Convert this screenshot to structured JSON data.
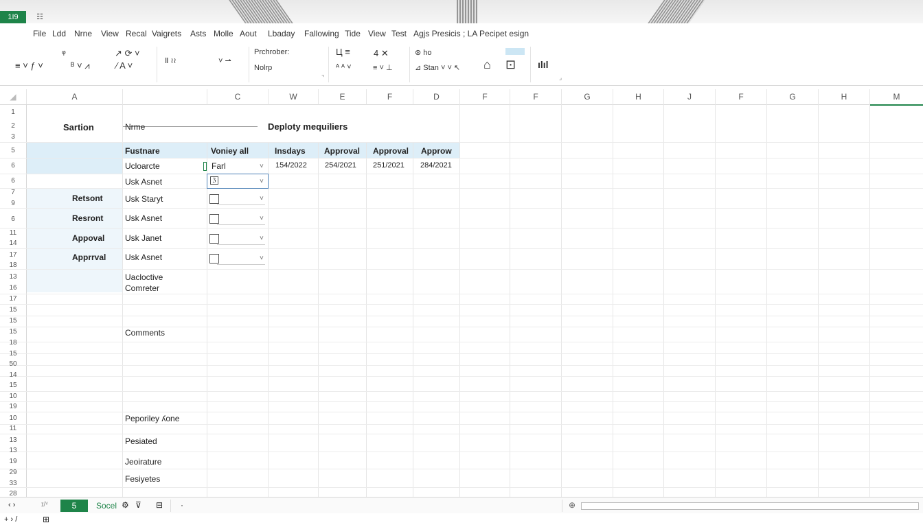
{
  "app": {
    "badge": "1I9",
    "grid_icon": "☷"
  },
  "menu": [
    "File",
    "Ldd",
    "Nrne",
    "View",
    "Recal",
    "Vaigrets",
    "Asts",
    "Molle",
    "Aout",
    "Lbaday",
    "Fallowing",
    "Tide",
    "View",
    "Test",
    "Agjs Presicis ; LA Pecipet esign"
  ],
  "ribbon": {
    "t1": "≡ ˅  ƒ  ˅",
    "t2": "ᵠ",
    "t3": "↗  ⟳  ˅",
    "t4": "ᴮ ˅  ⩘",
    "t5": "⁄  A  ˅",
    "t6": "Ⅱ ≀≀",
    "t7": "˅  ⇀",
    "t8": "Prchrober:",
    "t9": "Nolrp",
    "t10": "Ц  ≡",
    "t11": "ᴬ  ᴬ ˅",
    "t12": "4   ✕",
    "t13": "≡ ˅  ⊥",
    "t14": "⊛ ho",
    "t15": "⊿ Stan ˅  ˅  ↖",
    "t16": "⌂",
    "t17": "⊡",
    "t18": "ılıl",
    "t19": "⌝",
    "t20": "⌟"
  },
  "columns": [
    "A",
    "",
    "C",
    "W",
    "E",
    "F",
    "D",
    "F",
    "F",
    "G",
    "H",
    "J",
    "F",
    "G",
    "H",
    "M"
  ],
  "rows": [
    "1",
    "2",
    "3",
    "5",
    "6",
    "6",
    "7",
    "9",
    "6",
    "11",
    "14",
    "17",
    "18",
    "13",
    "16",
    "17",
    "15",
    "15",
    "15",
    "18",
    "15",
    "50",
    "14",
    "15",
    "10",
    "19",
    "10",
    "11",
    "13",
    "13",
    "19",
    "29",
    "33",
    "28"
  ],
  "sheet": {
    "section_label": "Sartion",
    "name_label": "Nrme",
    "title": "Deploty mequiliers",
    "headers": [
      "Fustnare",
      "Voniey all",
      "Insdays",
      "Approval",
      "Approval",
      "Approw"
    ],
    "row1": {
      "a": "Ucloarcte",
      "b": "Farl",
      "c": "154/2022",
      "d": "254/2021",
      "e": "251/2021",
      "f": "284/2021"
    },
    "row2_a": "Usk Asnet",
    "row2_b": "ℨ",
    "left_labels": [
      "Retsont",
      "Resront",
      "Appoval",
      "Apprrval"
    ],
    "item_labels": [
      "Usk Staryt",
      "Usk Asnet",
      "Usk Janet",
      "Usk Asnet"
    ],
    "misc": [
      "Uacloctive",
      "Comreter",
      "Comments",
      "Peporiley ʎone",
      "Pesiated",
      "Jeoirature",
      "Fesiyetes"
    ]
  },
  "tabs": {
    "nav": "‹  ›",
    "pages": "ɪ/ᵛ",
    "active": "5",
    "name": "Socel",
    "gear": "⚙",
    "filter": "⊽",
    "sheet_icon": "⊟",
    "dot": "·"
  },
  "status": {
    "left": "+ › /",
    "icon": "⊞",
    "zoom_icon": "⊕"
  },
  "colors": {
    "accent": "#1e8449",
    "header_fill": "#ddeef8"
  }
}
